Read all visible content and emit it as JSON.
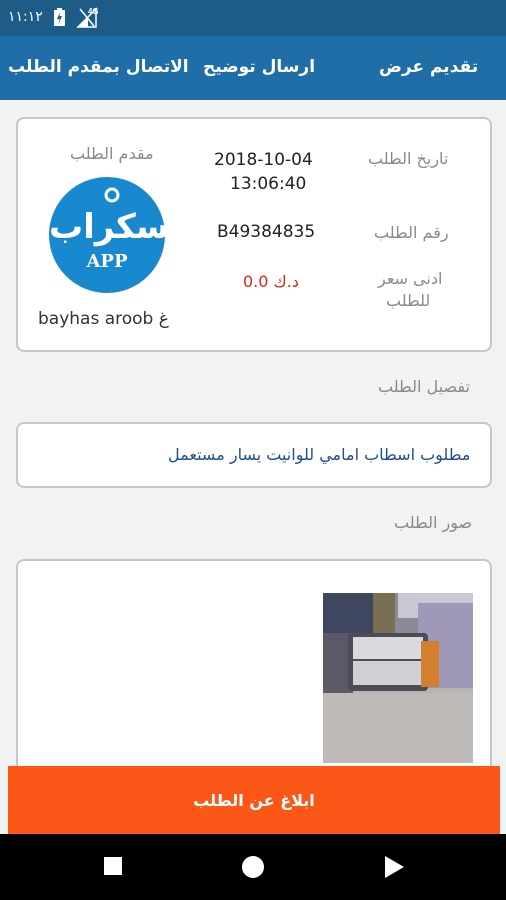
{
  "status_bar": {
    "time": "١١:١٢",
    "network": "4G",
    "icons": [
      "battery-charging-icon",
      "signal-icon"
    ]
  },
  "action_bar": {
    "submit_offer": "تقديم عرض",
    "send_clarification": "ارسال توضيح",
    "contact_requester": "الاتصال بمقدم الطلب"
  },
  "request_info": {
    "date_label": "تاريخ الطلب",
    "date_value": "2018-10-04",
    "time_value": "13:06:40",
    "number_label": "رقم الطلب",
    "number_value": "B49384835",
    "min_price_label_1": "ادنى سعر",
    "min_price_label_2": "للطلب",
    "min_price_value": "0.0 د.ك",
    "requester_label": "مقدم الطلب",
    "requester_name": "bayhas aroob غ",
    "logo_ar": "سكراب",
    "logo_en": "APP"
  },
  "details": {
    "title": "تفصيل الطلب",
    "text": "مطلوب اسطاب امامي للوانيت يسار مستعمل"
  },
  "images": {
    "title": "صور الطلب"
  },
  "report_button": "ابلاغ عن الطلب",
  "colors": {
    "status_bar": "#1e5c88",
    "action_bar": "#1f6ea8",
    "report": "#fb5818",
    "price": "#e2231a",
    "logo": "#1989cf"
  },
  "nav_icons": [
    "recents-square-icon",
    "home-circle-icon",
    "back-triangle-icon"
  ]
}
